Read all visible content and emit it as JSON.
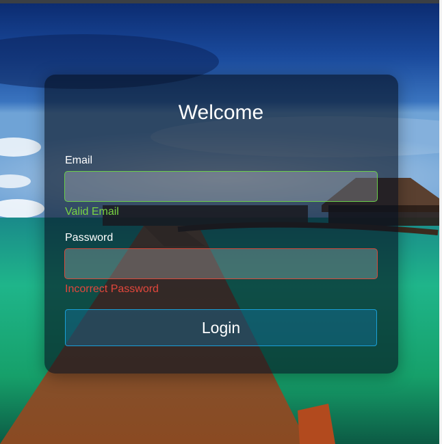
{
  "header": {
    "title": "Welcome"
  },
  "form": {
    "email_label": "Email",
    "email_value": "",
    "email_status": "Valid Email",
    "password_label": "Password",
    "password_value": "",
    "password_status": "Incorrect Password",
    "login_label": "Login"
  },
  "colors": {
    "valid": "#79d443",
    "invalid": "#e2473c",
    "button_border": "#1aa0d8"
  }
}
